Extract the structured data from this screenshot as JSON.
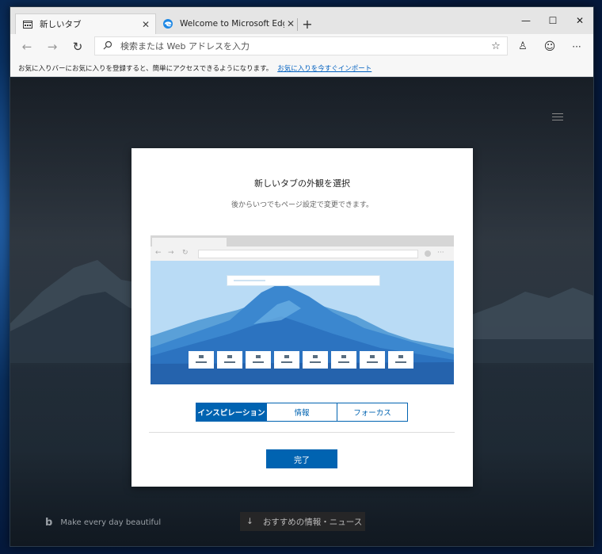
{
  "browser": {
    "tabs": [
      {
        "title": "新しいタブ",
        "icon": "new-tab-page-icon",
        "active": true
      },
      {
        "title": "Welcome to Microsoft Edge Dev",
        "icon": "edge-icon",
        "active": false
      }
    ],
    "new_tab_symbol": "+",
    "window_controls": {
      "minimize": "—",
      "maximize": "☐",
      "close": "✕"
    },
    "address_placeholder": "検索または Web アドレスを入力",
    "nav": {
      "back": "←",
      "forward": "→",
      "refresh": "↻"
    },
    "toolbar": {
      "favorite": "☆",
      "profile": "♙",
      "feedback": "☺",
      "more": "···"
    }
  },
  "favorites_bar": {
    "message": "お気に入りバーにお気に入りを登録すると、簡単にアクセスできるようになります。",
    "link": "お気に入りを今すぐインポート"
  },
  "page": {
    "bing_mark": "b",
    "tagline": "Make every day beautiful",
    "news_button": "おすすめの情報・ニュース",
    "news_arrow": "↓"
  },
  "modal": {
    "title": "新しいタブの外観を選択",
    "subtitle": "後からいつでもページ設定で変更できます。",
    "options": [
      "インスピレーション",
      "情報",
      "フォーカス"
    ],
    "selected_option": "インスピレーション",
    "done_button": "完了",
    "preview_tile_count": 8
  },
  "colors": {
    "accent": "#0063b1",
    "link": "#0060c0"
  }
}
